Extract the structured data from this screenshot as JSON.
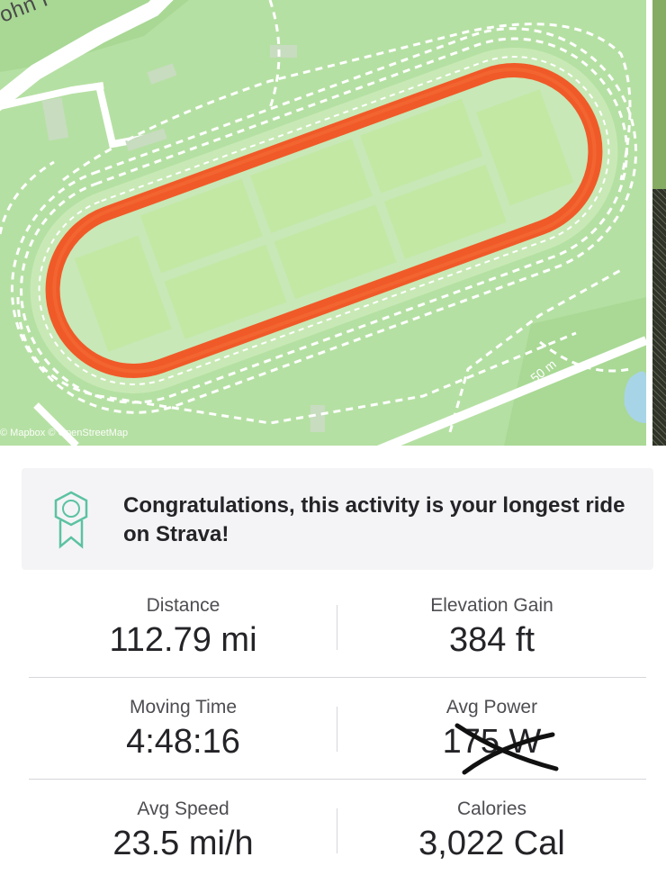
{
  "map": {
    "road_name": "John F Kennedy",
    "attribution": "© Mapbox © OpenStreetMap",
    "scale": "50 m",
    "route_color": "#f05a28"
  },
  "achievement": {
    "icon": "badge-icon",
    "text": "Congratulations, this activity is your longest ride on Strava!"
  },
  "stats": [
    {
      "left": {
        "label": "Distance",
        "value": "112.79 mi"
      },
      "right": {
        "label": "Elevation Gain",
        "value": "384 ft"
      }
    },
    {
      "left": {
        "label": "Moving Time",
        "value": "4:48:16"
      },
      "right": {
        "label": "Avg Power",
        "value": "175 W"
      }
    },
    {
      "left": {
        "label": "Avg Speed",
        "value": "23.5 mi/h"
      },
      "right": {
        "label": "Calories",
        "value": "3,022 Cal"
      }
    }
  ]
}
